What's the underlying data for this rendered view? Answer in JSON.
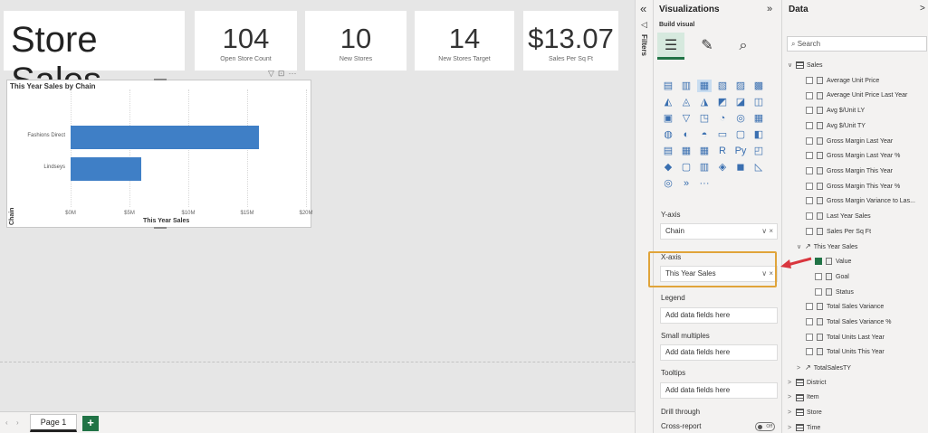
{
  "report": {
    "title": "Store Sales",
    "kpis": [
      {
        "value": "104",
        "label": "Open Store Count"
      },
      {
        "value": "10",
        "label": "New Stores"
      },
      {
        "value": "14",
        "label": "New Stores Target"
      },
      {
        "value": "$13.07",
        "label": "Sales Per Sq Ft"
      }
    ]
  },
  "chart_data": {
    "type": "bar",
    "orientation": "horizontal",
    "title": "This Year Sales by Chain",
    "xlabel": "This Year Sales",
    "ylabel": "Chain",
    "categories": [
      "Fashions Direct",
      "Lindseys"
    ],
    "values": [
      16,
      6
    ],
    "value_unit": "$M",
    "xlim": [
      0,
      20
    ],
    "x_ticks": [
      "$0M",
      "$5M",
      "$10M",
      "$15M",
      "$20M"
    ],
    "grid": true,
    "bar_color": "#3f7fc6"
  },
  "pages": {
    "tabs": [
      "Page 1"
    ],
    "add": "+"
  },
  "filters": {
    "label": "Filters",
    "collapse": "«"
  },
  "visualizations": {
    "title": "Visualizations",
    "collapse": "»",
    "build_label": "Build visual",
    "wells": {
      "y_axis_label": "Y-axis",
      "y_axis_value": "Chain",
      "x_axis_label": "X-axis",
      "x_axis_value": "This Year Sales",
      "legend_label": "Legend",
      "legend_placeholder": "Add data fields here",
      "small_multiples_label": "Small multiples",
      "small_multiples_placeholder": "Add data fields here",
      "tooltips_label": "Tooltips",
      "tooltips_placeholder": "Add data fields here",
      "drill_through_label": "Drill through",
      "cross_report_label": "Cross-report",
      "cross_report_toggle": "Off"
    },
    "well_controls": "∨ ×",
    "more_visuals": "···"
  },
  "data_pane": {
    "title": "Data",
    "close": ">",
    "search_placeholder": "Search",
    "tables": {
      "sales": "Sales",
      "sales_fields": [
        "Average Unit Price",
        "Average Unit Price Last Year",
        "Avg $/Unit LY",
        "Avg $/Unit TY",
        "Gross Margin Last Year",
        "Gross Margin Last Year %",
        "Gross Margin This Year",
        "Gross Margin This Year %",
        "Gross Margin Variance to Las...",
        "Last Year Sales",
        "Sales Per Sq Ft"
      ],
      "this_year_sales": "This Year Sales",
      "kpi_fields": [
        {
          "name": "Value",
          "checked": true
        },
        {
          "name": "Goal",
          "checked": false
        },
        {
          "name": "Status",
          "checked": false
        }
      ],
      "more_sales_fields": [
        "Total Sales Variance",
        "Total Sales Variance %",
        "Total Units Last Year",
        "Total Units This Year"
      ],
      "other": [
        "TotalSalesTY",
        "District",
        "Item",
        "Store",
        "Time"
      ]
    }
  },
  "colors": {
    "accent": "#217346",
    "highlight": "#e0a43a",
    "arrow": "#d9363e",
    "bar": "#3f7fc6"
  }
}
